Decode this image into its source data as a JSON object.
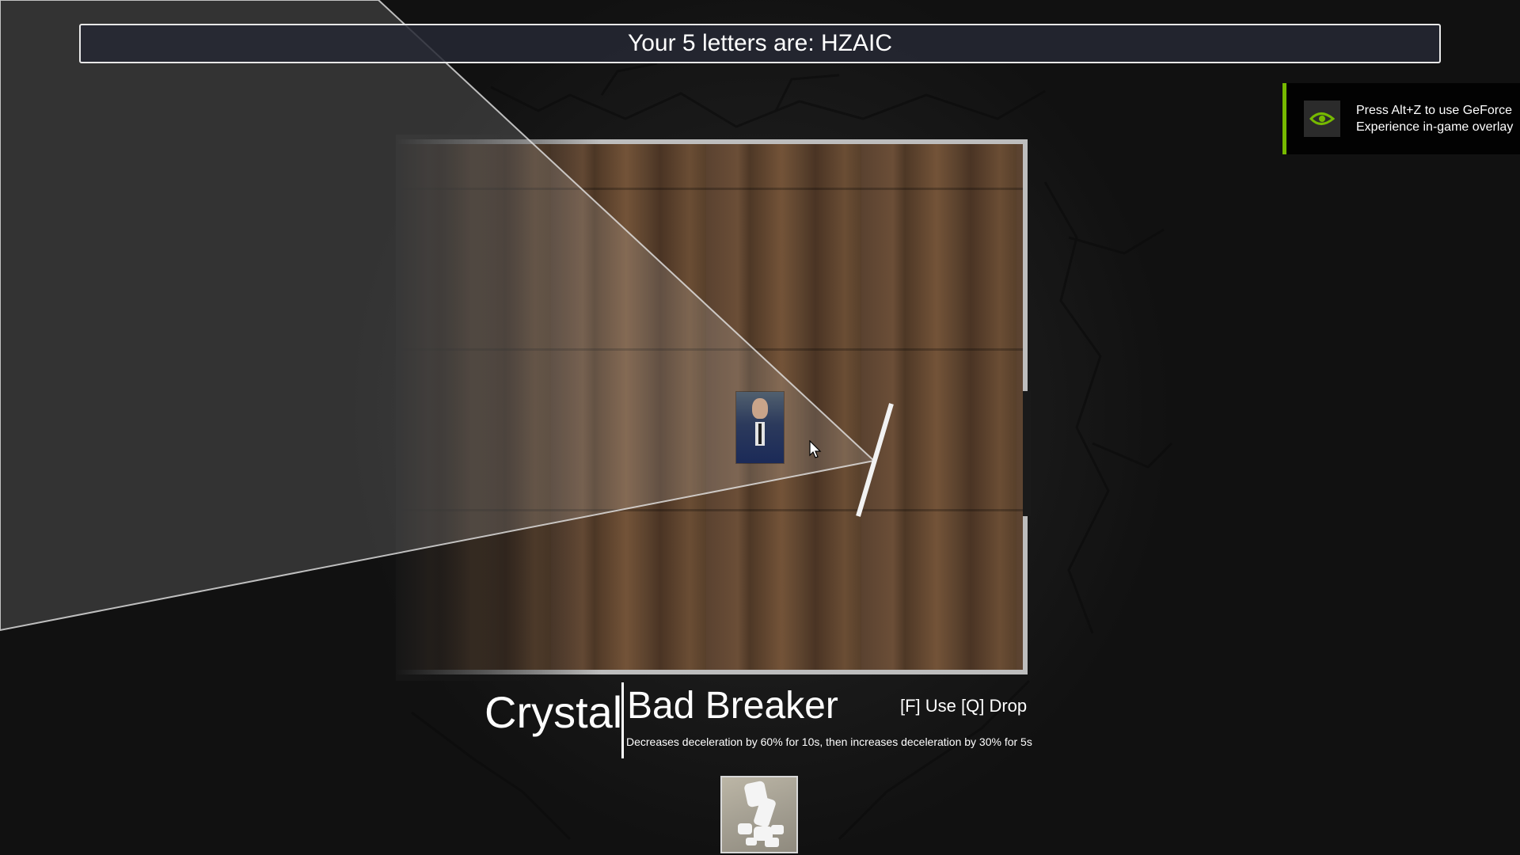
{
  "banner": {
    "text": "Your 5 letters are: HZAIC"
  },
  "overlay_notice": {
    "text": "Press Alt+Z to use GeForce Experience in-game overlay",
    "icon": "nvidia-logo-icon",
    "accent_color": "#76b900"
  },
  "item": {
    "name": "Crystal",
    "subtitle": "Bad Breaker",
    "keys": "[F] Use [Q] Drop",
    "description": "Decreases deceleration by 60% for 10s, then increases deceleration by 30% for 5s",
    "slot_icon": "crystal-item-icon"
  },
  "colors": {
    "background": "#111111",
    "banner_background": "#262834",
    "text": "#ffffff"
  }
}
